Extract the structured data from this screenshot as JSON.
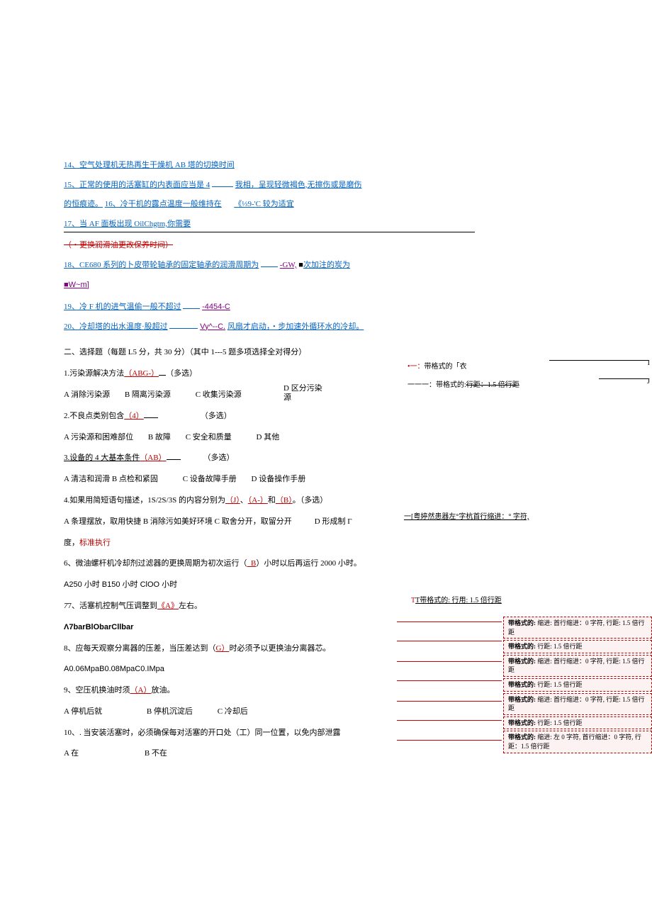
{
  "fill": {
    "q14": "14、空气处理机无热再生干燥机 AB 塔的切换时间",
    "q15a": "15、正常的使用的活塞缸的内表面应当是 4",
    "q15b": "我相，呈现轻微褐色,无擦伤或是磨伤",
    "q15c": "的恒痕迹。",
    "q16": "16、冷干机的露点温度一般维持在",
    "q16b": "《⅓9-'C 较为适宜",
    "q17": "17、当 AF 面板出现 OilChgtm,你需要",
    "q17strike": "（・更换润滑油更改保养时间）",
    "q18a": "18、CE680 系列的卜皮带轮轴承的固定轴承的润滑周期为",
    "q18b": "-GW,",
    "q18c": "次加注的炭为",
    "q18d": "■W~m]",
    "q19a": "19、冷 F 机的进气温偷一般不超过",
    "q19b": "-4454-C",
    "q20a": "20、冷却塔的出水温度·股超过",
    "q20b": "Vy^--C.",
    "q20c": "风扇才启动，・步加速外循环水的冷却。"
  },
  "section2": {
    "header": "二、选择题（每题 L5 分，共 30 分）（其中 1---5 题多项选择全对得分）",
    "q1": {
      "stem": "1.污染源解决方法",
      "ans": "（ABG-）",
      "tag": "（多选）",
      "A": "A 消除污染源",
      "B": "B 隔离污染源",
      "C": "C 收集污染源",
      "D": "D 区分污染源"
    },
    "q2": {
      "stem": "2.不良点类别包含",
      "ans": "（4）",
      "tag": "（多选）",
      "A": "A 污染源和困难部位",
      "B": "B 故障",
      "C": "C 安全和质量",
      "D": "D 其他"
    },
    "q3": {
      "stem": "3.设备的 4 大基本条件",
      "ans": "（AB）",
      "tag": "（多选）",
      "A": "A 清洁和润滑 B 点检和紧固",
      "C": "C 设备故障手册",
      "D": "D 设备操作手册"
    },
    "q4": {
      "stem_a": "4.如果用简短语句描述，1S/2S/3S 的内容分别为",
      "ans_j": "（J）",
      "sep1": "、",
      "ans_a": "（A-）",
      "sep2": "和",
      "ans_b": "（B）",
      "tail": "。（多选）",
      "optA": "A 条理摆放，取用快捷 B 消除污如美好环境 C 取舍分开，取留分开",
      "optD": "D 形成制 Γ",
      "line2": "度，",
      "line2b": "标准执行"
    },
    "q6": {
      "stem_a": "6、微油螺杆机冷却剂过滤器的更换周期为初次运行（",
      "ans": "_B",
      "stem_b": "）小时以后再运行 2000 小时。",
      "opts": "A250 小时 B150 小时 ClOO 小时"
    },
    "q7": {
      "stem_a": "7、活塞机控制气压调整到",
      "ans": "《A》",
      "stem_b": "左右。",
      "opts": "Λ7barBlObarCllbar"
    },
    "q8": {
      "stem_a": "8、应每天观察分离器的压差，当压差达到（",
      "ans": "G）",
      "stem_b": "时必须予以更换油分离器芯。",
      "opts": "A0.06MpaB0.08MpaC0.IMpa"
    },
    "q9": {
      "stem_a": "9、空压机换油时须",
      "ans": "（A）",
      "stem_b": "放油。",
      "A": "A 停机后就",
      "B": "B 停机沉淀后",
      "C": "C 冷却后"
    },
    "q10": {
      "stem": "10、. 当安装活塞时，必须确保每对活塞的开口处（工）同一位置，以免内部泄露",
      "A": "A 在",
      "B": "B 不在"
    }
  },
  "sideNotes": {
    "n1": "带格式的「衣",
    "n2a": "带格式的:",
    "n2b": "行距：1.5 倍行距",
    "n3": "[粤婷然患器左°字杭首行缩进：° 字符,",
    "topnote": "T带格式的: 行用: 1.5 倍行距"
  },
  "callouts": {
    "c1": "带格式的: 缩进: 首行缩进：0 字符, 行距: 1.5 倍行距",
    "c2": "带格式的: 行距: 1.5 倍行距",
    "c3": "带格式的: 缩进: 首行缩进：0 字符, 行距: 1.5 倍行距",
    "c4": "带格式的: 行距: 1.5 倍行距",
    "c5": "带格式的: 缩进: 首行缩进：0 字符, 行距: 1.5 倍行距",
    "c6": "带格式的: 行距: 1.5 倍行距",
    "c7": "带格式的: 缩进: 左 0 字符, 首行缩进：0 字符, 行距：1.5 倍行距"
  }
}
